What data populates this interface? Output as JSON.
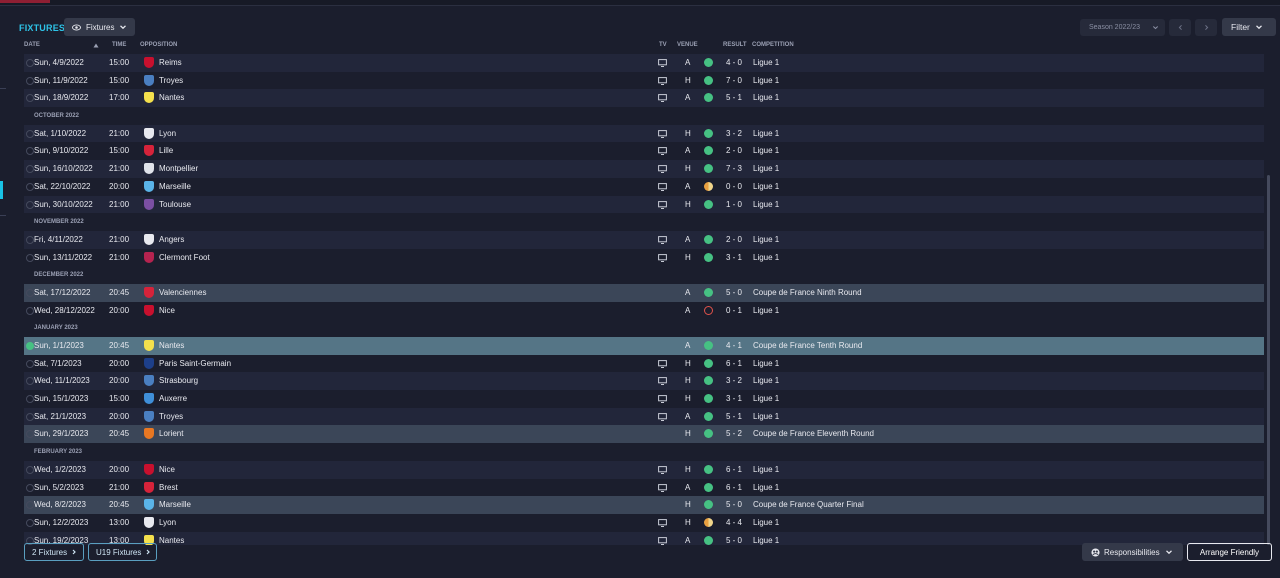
{
  "header": {
    "title": "FIXTURES",
    "view_dropdown": "Fixtures",
    "season": "Season 2022/23",
    "filter": "Filter"
  },
  "columns": {
    "date": "DATE",
    "time": "TIME",
    "opposition": "OPPOSITION",
    "tv": "TV",
    "venue": "VENUE",
    "result": "RESULT",
    "competition": "COMPETITION"
  },
  "colors": {
    "accent": "#2ec4e8",
    "win": "#46c183",
    "draw": "#e8a040",
    "loss": "#e0524b",
    "selected_row": "#557586",
    "cup_row": "#3b4658"
  },
  "fixtures": [
    {
      "kind": "match",
      "date": "Sun, 4/9/2022",
      "time": "15:00",
      "opp": "Reims",
      "tv": true,
      "venue": "A",
      "outcome": "W",
      "score": "4 - 0",
      "comp": "Ligue 1",
      "crest": "#c8102e"
    },
    {
      "kind": "match",
      "date": "Sun, 11/9/2022",
      "time": "15:00",
      "opp": "Troyes",
      "tv": true,
      "venue": "H",
      "outcome": "W",
      "score": "7 - 0",
      "comp": "Ligue 1",
      "crest": "#4a7fc1"
    },
    {
      "kind": "match",
      "date": "Sun, 18/9/2022",
      "time": "17:00",
      "opp": "Nantes",
      "tv": true,
      "venue": "A",
      "outcome": "W",
      "score": "5 - 1",
      "comp": "Ligue 1",
      "crest": "#f4e04d"
    },
    {
      "kind": "month",
      "label": "OCTOBER 2022"
    },
    {
      "kind": "match",
      "date": "Sat, 1/10/2022",
      "time": "21:00",
      "opp": "Lyon",
      "tv": true,
      "venue": "H",
      "outcome": "W",
      "score": "3 - 2",
      "comp": "Ligue 1",
      "crest": "#e8e9ef"
    },
    {
      "kind": "match",
      "date": "Sun, 9/10/2022",
      "time": "15:00",
      "opp": "Lille",
      "tv": true,
      "venue": "A",
      "outcome": "W",
      "score": "2 - 0",
      "comp": "Ligue 1",
      "crest": "#d6233a"
    },
    {
      "kind": "match",
      "date": "Sun, 16/10/2022",
      "time": "21:00",
      "opp": "Montpellier",
      "tv": true,
      "venue": "H",
      "outcome": "W",
      "score": "7 - 3",
      "comp": "Ligue 1",
      "crest": "#e0e3ea"
    },
    {
      "kind": "match",
      "date": "Sat, 22/10/2022",
      "time": "20:00",
      "opp": "Marseille",
      "tv": true,
      "venue": "A",
      "outcome": "D",
      "score": "0 - 0",
      "comp": "Ligue 1",
      "crest": "#5ab4e8"
    },
    {
      "kind": "match",
      "date": "Sun, 30/10/2022",
      "time": "21:00",
      "opp": "Toulouse",
      "tv": true,
      "venue": "H",
      "outcome": "W",
      "score": "1 - 0",
      "comp": "Ligue 1",
      "crest": "#7b4fa3"
    },
    {
      "kind": "month",
      "label": "NOVEMBER 2022"
    },
    {
      "kind": "match",
      "date": "Fri, 4/11/2022",
      "time": "21:00",
      "opp": "Angers",
      "tv": true,
      "venue": "A",
      "outcome": "W",
      "score": "2 - 0",
      "comp": "Ligue 1",
      "crest": "#e8e9ef"
    },
    {
      "kind": "match",
      "date": "Sun, 13/11/2022",
      "time": "21:00",
      "opp": "Clermont Foot",
      "tv": true,
      "venue": "H",
      "outcome": "W",
      "score": "3 - 1",
      "comp": "Ligue 1",
      "crest": "#b5234f"
    },
    {
      "kind": "month",
      "label": "DECEMBER 2022"
    },
    {
      "kind": "match",
      "date": "Sat, 17/12/2022",
      "time": "20:45",
      "opp": "Valenciennes",
      "tv": false,
      "venue": "A",
      "outcome": "W",
      "score": "5 - 0",
      "comp": "Coupe de France Ninth Round",
      "crest": "#d6233a",
      "cup": true
    },
    {
      "kind": "match",
      "date": "Wed, 28/12/2022",
      "time": "20:00",
      "opp": "Nice",
      "tv": false,
      "venue": "A",
      "outcome": "L",
      "score": "0 - 1",
      "comp": "Ligue 1",
      "crest": "#c8102e"
    },
    {
      "kind": "month",
      "label": "JANUARY 2023"
    },
    {
      "kind": "match",
      "date": "Sun, 1/1/2023",
      "time": "20:45",
      "opp": "Nantes",
      "tv": false,
      "venue": "A",
      "outcome": "W",
      "score": "4 - 1",
      "comp": "Coupe de France Tenth Round",
      "crest": "#f4e04d",
      "selected": true
    },
    {
      "kind": "match",
      "date": "Sat, 7/1/2023",
      "time": "20:00",
      "opp": "Paris Saint-Germain",
      "tv": true,
      "venue": "H",
      "outcome": "W",
      "score": "6 - 1",
      "comp": "Ligue 1",
      "crest": "#1d3f8a"
    },
    {
      "kind": "match",
      "date": "Wed, 11/1/2023",
      "time": "20:00",
      "opp": "Strasbourg",
      "tv": true,
      "venue": "H",
      "outcome": "W",
      "score": "3 - 2",
      "comp": "Ligue 1",
      "crest": "#4a7fc1"
    },
    {
      "kind": "match",
      "date": "Sun, 15/1/2023",
      "time": "15:00",
      "opp": "Auxerre",
      "tv": true,
      "venue": "H",
      "outcome": "W",
      "score": "3 - 1",
      "comp": "Ligue 1",
      "crest": "#3f8fd8"
    },
    {
      "kind": "match",
      "date": "Sat, 21/1/2023",
      "time": "20:00",
      "opp": "Troyes",
      "tv": true,
      "venue": "A",
      "outcome": "W",
      "score": "5 - 1",
      "comp": "Ligue 1",
      "crest": "#4a7fc1"
    },
    {
      "kind": "match",
      "date": "Sun, 29/1/2023",
      "time": "20:45",
      "opp": "Lorient",
      "tv": false,
      "venue": "H",
      "outcome": "W",
      "score": "5 - 2",
      "comp": "Coupe de France Eleventh Round",
      "crest": "#e87722",
      "cup": true
    },
    {
      "kind": "month",
      "label": "FEBRUARY 2023"
    },
    {
      "kind": "match",
      "date": "Wed, 1/2/2023",
      "time": "20:00",
      "opp": "Nice",
      "tv": true,
      "venue": "H",
      "outcome": "W",
      "score": "6 - 1",
      "comp": "Ligue 1",
      "crest": "#c8102e"
    },
    {
      "kind": "match",
      "date": "Sun, 5/2/2023",
      "time": "21:00",
      "opp": "Brest",
      "tv": true,
      "venue": "A",
      "outcome": "W",
      "score": "6 - 1",
      "comp": "Ligue 1",
      "crest": "#d6233a"
    },
    {
      "kind": "match",
      "date": "Wed, 8/2/2023",
      "time": "20:45",
      "opp": "Marseille",
      "tv": false,
      "venue": "H",
      "outcome": "W",
      "score": "5 - 0",
      "comp": "Coupe de France Quarter Final",
      "crest": "#5ab4e8",
      "cup": true
    },
    {
      "kind": "match",
      "date": "Sun, 12/2/2023",
      "time": "13:00",
      "opp": "Lyon",
      "tv": true,
      "venue": "H",
      "outcome": "D",
      "score": "4 - 4",
      "comp": "Ligue 1",
      "crest": "#e8e9ef"
    },
    {
      "kind": "match",
      "date": "Sun, 19/2/2023",
      "time": "13:00",
      "opp": "Nantes",
      "tv": true,
      "venue": "A",
      "outcome": "W",
      "score": "5 - 0",
      "comp": "Ligue 1",
      "crest": "#f4e04d"
    }
  ],
  "footer": {
    "link1": "2 Fixtures",
    "link2": "U19 Fixtures",
    "responsibilities": "Responsibilities",
    "arrange": "Arrange Friendly"
  }
}
